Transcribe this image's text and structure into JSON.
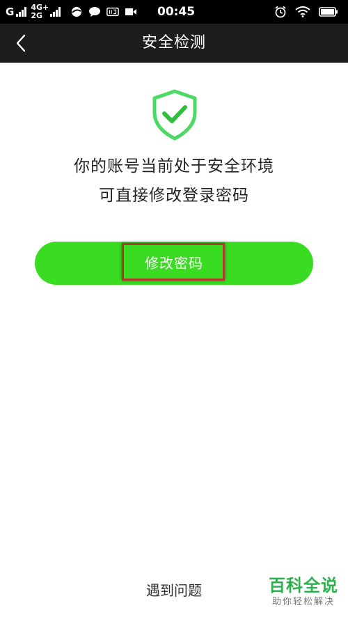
{
  "status_bar": {
    "carrier": "G",
    "network_top": "4G+",
    "network_bottom": "2G",
    "time": "00:45"
  },
  "header": {
    "title": "安全检测"
  },
  "main": {
    "message_line1": "你的账号当前处于安全环境",
    "message_line2": "可直接修改登录密码",
    "primary_button_label": "修改密码"
  },
  "footer": {
    "help_link": "遇到问题"
  },
  "watermark": {
    "title": "百科全说",
    "subtitle": "助你轻松解决"
  },
  "colors": {
    "accent_green": "#3adc22",
    "shield_green": "#4cd964",
    "header_bg": "#1d1d1d",
    "highlight_red": "#b03a2e"
  }
}
